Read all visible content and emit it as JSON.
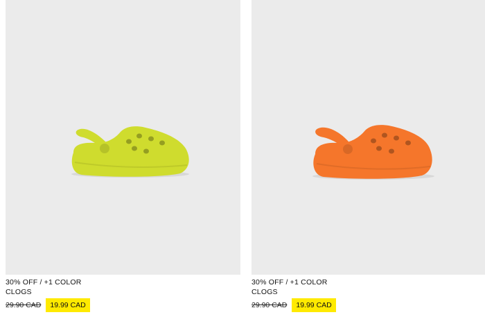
{
  "products": [
    {
      "promo": "30% OFF / +1 COLOR",
      "name": "CLOGS",
      "old_price": "29.90 CAD",
      "new_price": "19.99 CAD",
      "color": "#cfdc2e",
      "image_icon": "clog-shoe-image"
    },
    {
      "promo": "30% OFF / +1 COLOR",
      "name": "CLOGS",
      "old_price": "29.90 CAD",
      "new_price": "19.99 CAD",
      "color": "#f5762b",
      "image_icon": "clog-shoe-image"
    }
  ],
  "colors": {
    "photo_bg": "#ebebeb",
    "price_highlight": "#ffea00"
  }
}
